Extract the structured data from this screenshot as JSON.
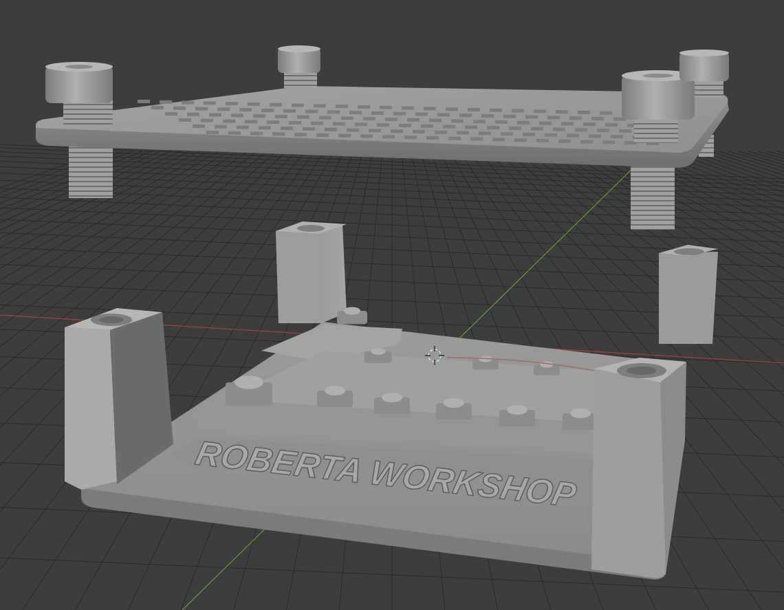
{
  "viewport": {
    "background": "#3d3d3d",
    "grid_color": "#2a2a2a",
    "x_axis_color": "#b5474f",
    "y_axis_color": "#7fae2e",
    "model_color": "#9a9a9a",
    "model_shadow_color": "#5e5e5e"
  },
  "model": {
    "engraved_text": "ROBERTA WORKSHOP"
  }
}
